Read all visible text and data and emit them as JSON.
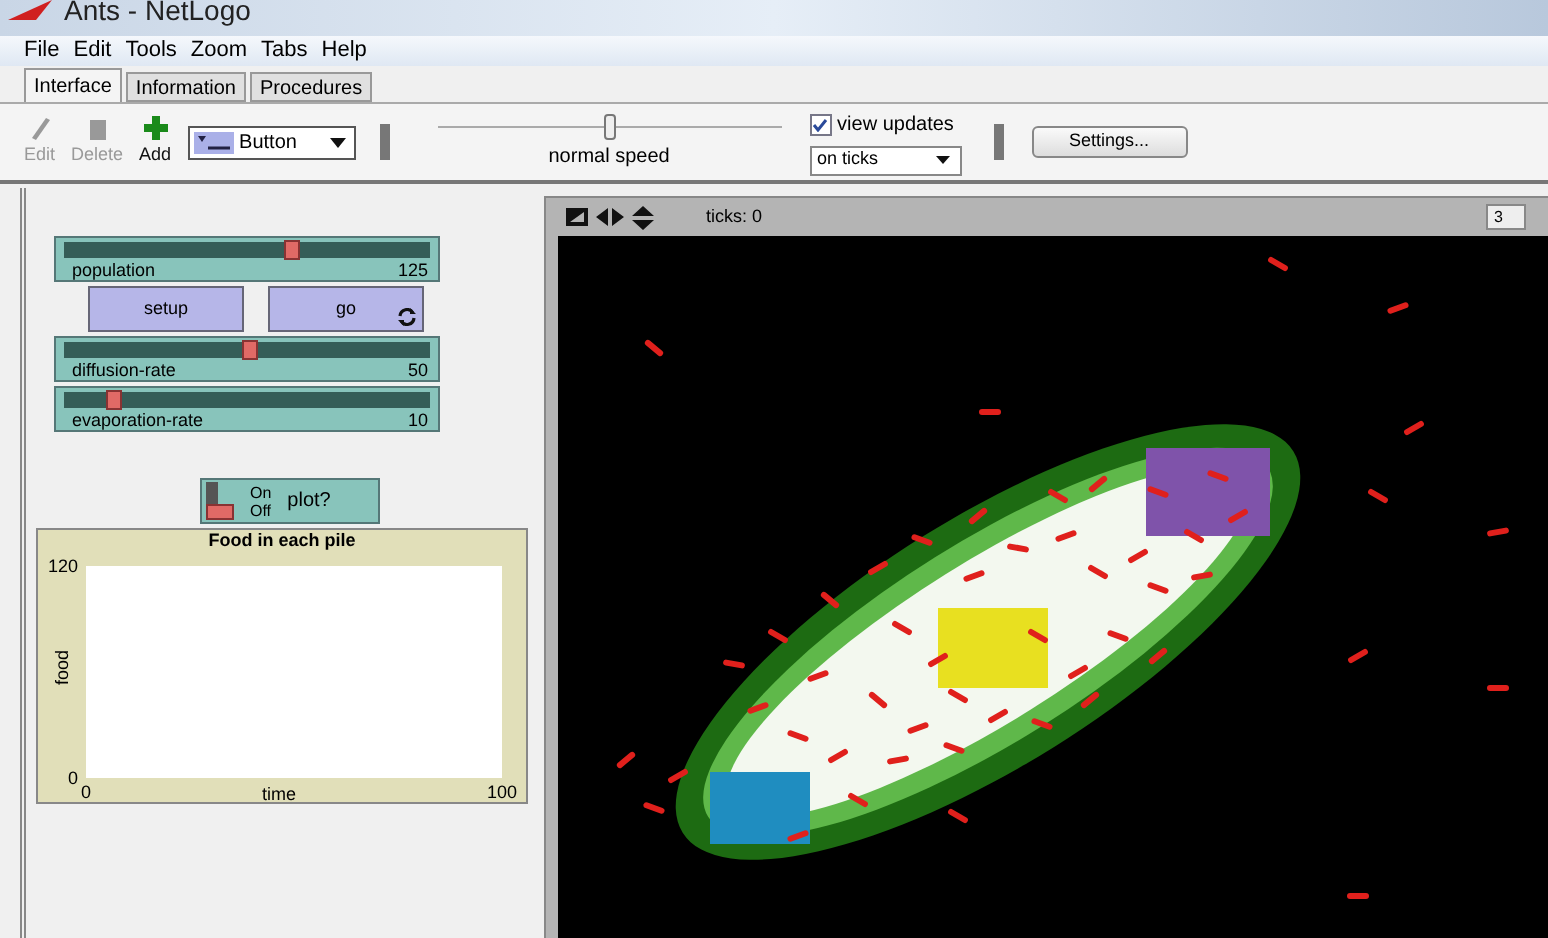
{
  "window": {
    "title": "Ants - NetLogo"
  },
  "menu": [
    "File",
    "Edit",
    "Tools",
    "Zoom",
    "Tabs",
    "Help"
  ],
  "tabs": [
    {
      "label": "Interface",
      "selected": true
    },
    {
      "label": "Information",
      "selected": false
    },
    {
      "label": "Procedures",
      "selected": false
    }
  ],
  "toolbar": {
    "tools": [
      {
        "label": "Edit",
        "disabled": true
      },
      {
        "label": "Delete",
        "disabled": true
      },
      {
        "label": "Add",
        "disabled": false
      }
    ],
    "widget_type": "Button",
    "speed": {
      "label": "normal speed",
      "level": 0.5
    },
    "view_updates": {
      "label": "view updates",
      "checked": true
    },
    "update_mode": "on ticks",
    "settings": "Settings..."
  },
  "widgets": [
    {
      "kind": "slider",
      "label": "population",
      "value": "125",
      "level": 0.62
    },
    {
      "kind": "buttons",
      "buttons": [
        {
          "label": "setup",
          "forever": false
        },
        {
          "label": "go",
          "forever": true
        }
      ]
    },
    {
      "kind": "slider",
      "label": "diffusion-rate",
      "value": "50",
      "level": 0.5
    },
    {
      "kind": "slider",
      "label": "evaporation-rate",
      "value": "10",
      "level": 0.12
    }
  ],
  "switch": {
    "label": "plot?",
    "on_label": "On",
    "off_label": "Off",
    "on": false
  },
  "plot": {
    "chart_data": {
      "type": "line",
      "title": "Food in each pile",
      "xlabel": "time",
      "ylabel": "food",
      "xlim": [
        0,
        100
      ],
      "ylim": [
        0,
        120
      ],
      "xticks": [
        0,
        100
      ],
      "yticks": [
        0,
        120
      ]
    }
  },
  "view": {
    "ticks": "ticks: 0",
    "three_d": "3"
  }
}
